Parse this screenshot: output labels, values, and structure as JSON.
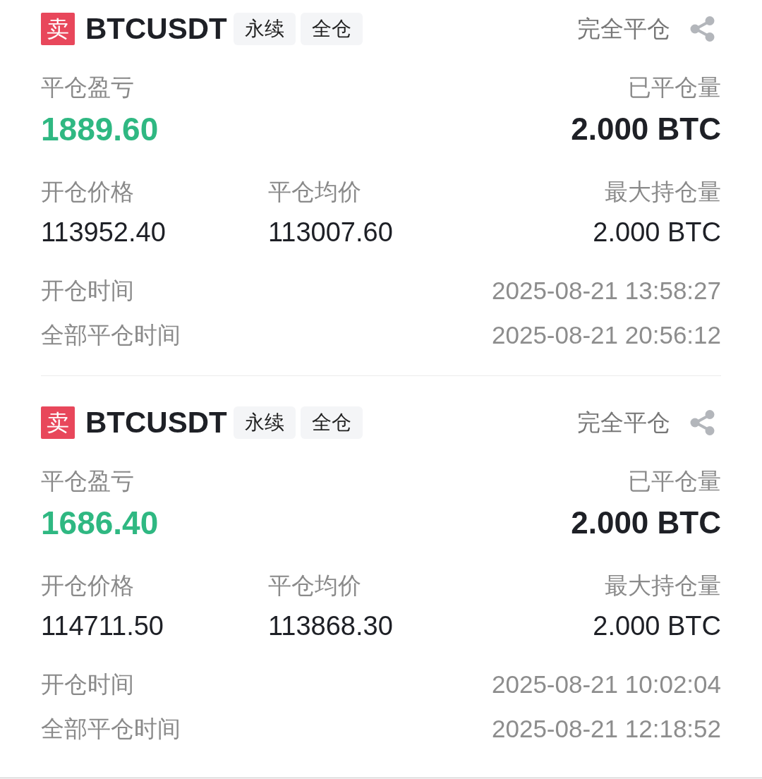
{
  "orders": [
    {
      "side": {
        "label": "卖",
        "kind": "sell"
      },
      "symbol": "BTCUSDT",
      "tags": [
        "永续",
        "全仓"
      ],
      "status": "完全平仓",
      "pnl": {
        "label": "平仓盈亏",
        "value": "1889.60",
        "positive": true
      },
      "closed_qty": {
        "label": "已平仓量",
        "value": "2.000 BTC"
      },
      "open_price": {
        "label": "开仓价格",
        "value": "113952.40"
      },
      "close_avg_price": {
        "label": "平仓均价",
        "value": "113007.60"
      },
      "max_position": {
        "label": "最大持仓量",
        "value": "2.000 BTC"
      },
      "times": [
        {
          "label": "开仓时间",
          "value": "2025-08-21 13:58:27"
        },
        {
          "label": "全部平仓时间",
          "value": "2025-08-21 20:56:12"
        }
      ]
    },
    {
      "side": {
        "label": "卖",
        "kind": "sell"
      },
      "symbol": "BTCUSDT",
      "tags": [
        "永续",
        "全仓"
      ],
      "status": "完全平仓",
      "pnl": {
        "label": "平仓盈亏",
        "value": "1686.40",
        "positive": true
      },
      "closed_qty": {
        "label": "已平仓量",
        "value": "2.000 BTC"
      },
      "open_price": {
        "label": "开仓价格",
        "value": "114711.50"
      },
      "close_avg_price": {
        "label": "平仓均价",
        "value": "113868.30"
      },
      "max_position": {
        "label": "最大持仓量",
        "value": "2.000 BTC"
      },
      "times": [
        {
          "label": "开仓时间",
          "value": "2025-08-21 10:02:04"
        },
        {
          "label": "全部平仓时间",
          "value": "2025-08-21 12:18:52"
        }
      ]
    }
  ]
}
